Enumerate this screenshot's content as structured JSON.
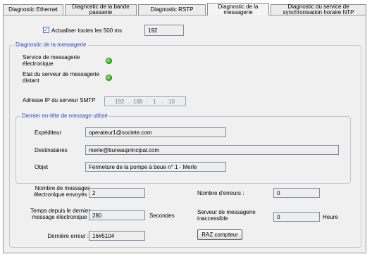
{
  "tabs": [
    {
      "label": "Diagnostic Ethernet",
      "active": false
    },
    {
      "label": "Diagnostic de la bande passante",
      "active": false
    },
    {
      "label": "Diagnostic RSTP",
      "active": false
    },
    {
      "label": "Diagnostic de la messagerie",
      "active": true
    },
    {
      "label": "Diagnostic du service de synchronisation horaire NTP",
      "active": false
    }
  ],
  "refresh": {
    "label": "Actualiser toutes les 500 ms",
    "checked": true,
    "value": "192"
  },
  "messaging_group": {
    "title": "Diagnostic de la messagerie",
    "service_label": "Service de messagerie électronique",
    "remote_server_label": "Etat du serveur de messagerie distant",
    "smtp_ip_label": "Adresse IP du serveur SMTP",
    "smtp_ip": [
      "192",
      "168",
      "1",
      "10"
    ],
    "status_color": "#2fae1e"
  },
  "last_header_group": {
    "title": "Dernier en-tête de message utilisé",
    "sender_label": "Expéditeur",
    "sender_value": "operateur1@societe.com",
    "recipients_label": "Destinataires",
    "recipients_value": "merle@bureauprincipal.com",
    "subject_label": "Objet",
    "subject_value": "Fermeture de la pompe à boue n° 1 - Merle"
  },
  "stats": {
    "sent_label": "Nombre de messages électronique envoyés :",
    "sent_value": "2",
    "errors_label": "Nombre d'erreurs :",
    "errors_value": "0",
    "time_label": "Temps depuis le dernier message électronique :",
    "time_value": "280",
    "time_unit": "Secondes",
    "unreachable_label": "Serveur de messagerie inaccessible",
    "unreachable_value": "0",
    "unreachable_unit": "Heure",
    "last_error_label": "Dernière erreur :",
    "last_error_value": "16#5104",
    "reset_button": "RAZ compteur"
  }
}
